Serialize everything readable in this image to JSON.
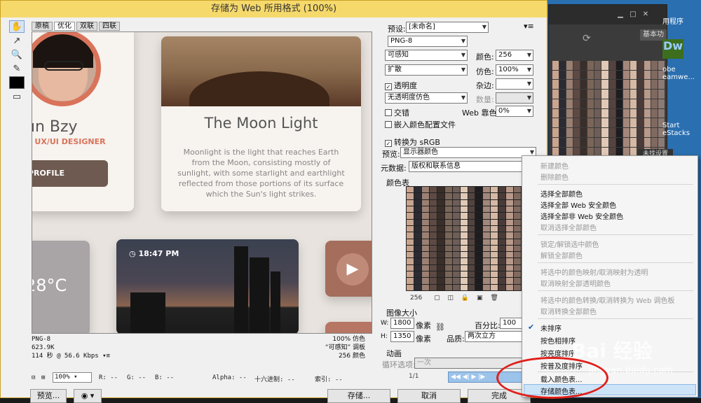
{
  "window": {
    "title": "存储为 Web 所用格式 (100%)"
  },
  "tabs": [
    "原稿",
    "优化",
    "双联",
    "四联"
  ],
  "preview": {
    "name": "un Bzy",
    "role": "& UX/UI DESIGNER",
    "profile_btn": "PROFILE",
    "moon_title": "The Moon Light",
    "moon_text": "Moonlight is the light that reaches Earth from the Moon, consisting mostly of sunlight, with some starlight and earthlight reflected from those portions of its surface which the Sun's light strikes.",
    "time": "18:47 PM",
    "temp": "28°C",
    "play": "▶"
  },
  "status": {
    "format": "PNG-8",
    "size": "623.9K",
    "speed": "114 秒 @ 56.6 Kbps",
    "dither": "100% 仿色",
    "palette": "“可感知” 调板",
    "colors": "256 颜色"
  },
  "bottom": {
    "zoom": "100%",
    "r": "R: --",
    "g": "G: --",
    "b": "B: --",
    "alpha": "Alpha: --",
    "hex": "十六进制: --",
    "index": "索引: --"
  },
  "buttons": {
    "preview": "预览...",
    "save": "存储...",
    "cancel": "取消",
    "done": "完成"
  },
  "panel": {
    "preset_label": "预设:",
    "preset_value": "[未命名]",
    "format": "PNG-8",
    "reduction": "可感知",
    "colors_label": "颜色:",
    "colors_value": "256",
    "dither_algo": "扩散",
    "dither_label": "仿色:",
    "dither_value": "100%",
    "transparency": "透明度",
    "matte_label": "杂边:",
    "trans_dither": "无透明度仿色",
    "amount_label": "数量:",
    "interlaced": "交错",
    "web_snap_label": "Web 靠色:",
    "web_snap_value": "0%",
    "embed_profile": "嵌入颜色配置文件",
    "convert_srgb": "转换为 sRGB",
    "preview_label": "预览:",
    "preview_value": "显示器颜色",
    "metadata_label": "元数据:",
    "metadata_value": "版权和联系信息",
    "color_table_label": "颜色表",
    "color_count": "256",
    "image_size_label": "图像大小",
    "w_label": "W:",
    "w_value": "1800",
    "h_label": "H:",
    "h_value": "1350",
    "px": "像素",
    "percent_label": "百分比:",
    "percent_value": "100",
    "quality_label": "品质:",
    "quality_value": "两次立方",
    "anim_label": "动画",
    "loop_label": "循环选项:",
    "loop_value": "一次",
    "frame": "1/1"
  },
  "menu": {
    "items": [
      "新建颜色",
      "删除颜色",
      "选择全部颜色",
      "选择全部 Web 安全颜色",
      "选择全部非 Web 安全颜色",
      "取消选择全部颜色",
      "锁定/解锁选中颜色",
      "解锁全部颜色",
      "将选中的颜色映射/取消映射为透明",
      "取消映射全部透明颜色",
      "将选中的颜色转换/取消转换为 Web 调色板",
      "取消转换全部颜色",
      "未排序",
      "按色相排序",
      "按亮度排序",
      "按普及度排序",
      "载入颜色表...",
      "存储颜色表..."
    ]
  },
  "background": {
    "desktop_icons": [
      "用程序",
      "Dw",
      "obe eamwe...",
      "Start eStacks"
    ],
    "basic_btn": "基本功",
    "settings_btn": "未找设置",
    "watermark": "Bai 经验",
    "watermark_url": "jingyan.baidu.com"
  },
  "colors": {
    "title_bar": "#f6d96b",
    "accent": "#d9735a",
    "highlight": "#cde3f7",
    "annotation": "#e0201b"
  }
}
